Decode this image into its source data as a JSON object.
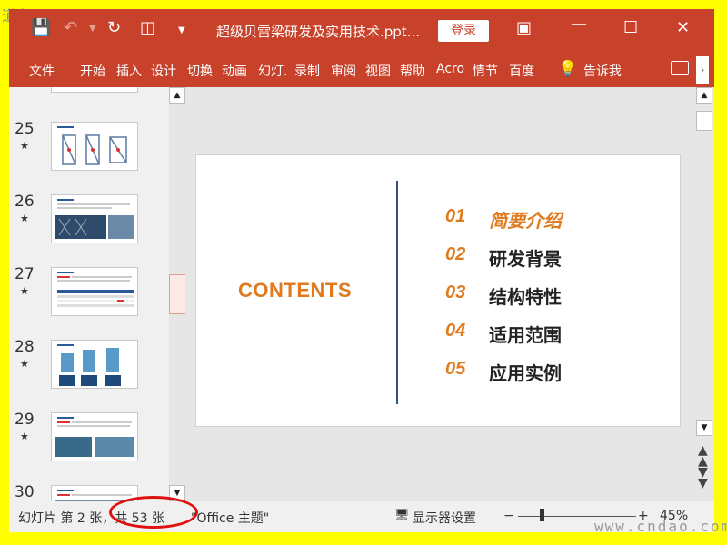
{
  "watermark_top": "道标网",
  "watermark_bottom": "www.cndao.com",
  "titlebar": {
    "save_icon": "save-icon",
    "undo_icon": "undo-icon",
    "redo_icon": "redo-icon",
    "present_icon": "present-icon",
    "customize_icon": "customize-icon",
    "doc_title": "超级贝雷梁研发及实用技术.ppt...",
    "login_label": "登录",
    "ribbon_display_icon": "ribbon-display-icon",
    "minimize_icon": "minimize-icon",
    "maximize_icon": "maximize-icon",
    "close_icon": "close-icon"
  },
  "ribbon": {
    "tabs": [
      "文件",
      "开始",
      "插入",
      "设计",
      "切换",
      "动画",
      "幻灯.",
      "录制",
      "审阅",
      "视图",
      "帮助",
      "Acro",
      "情节",
      "百度"
    ],
    "tell_me": "告诉我"
  },
  "thumbnails": [
    {
      "number": "25"
    },
    {
      "number": "26"
    },
    {
      "number": "27"
    },
    {
      "number": "28"
    },
    {
      "number": "29"
    },
    {
      "number": "30"
    }
  ],
  "slide": {
    "contents_title": "CONTENTS",
    "toc": [
      {
        "num": "01",
        "label": "简要介绍"
      },
      {
        "num": "02",
        "label": "研发背景"
      },
      {
        "num": "03",
        "label": "结构特性"
      },
      {
        "num": "04",
        "label": "适用范围"
      },
      {
        "num": "05",
        "label": "应用实例"
      }
    ]
  },
  "statusbar": {
    "slide_position": "幻灯片 第 2 张，共 53 张",
    "theme": "\"Office 主题\"",
    "display_settings": "显示器设置",
    "zoom_minus": "−",
    "zoom_plus": "+",
    "zoom_level": "45%"
  },
  "colors": {
    "titlebar": "#c8412a",
    "accent_orange": "#e07a1f",
    "divider": "#33557a",
    "highlight_ellipse": "#e01010"
  }
}
